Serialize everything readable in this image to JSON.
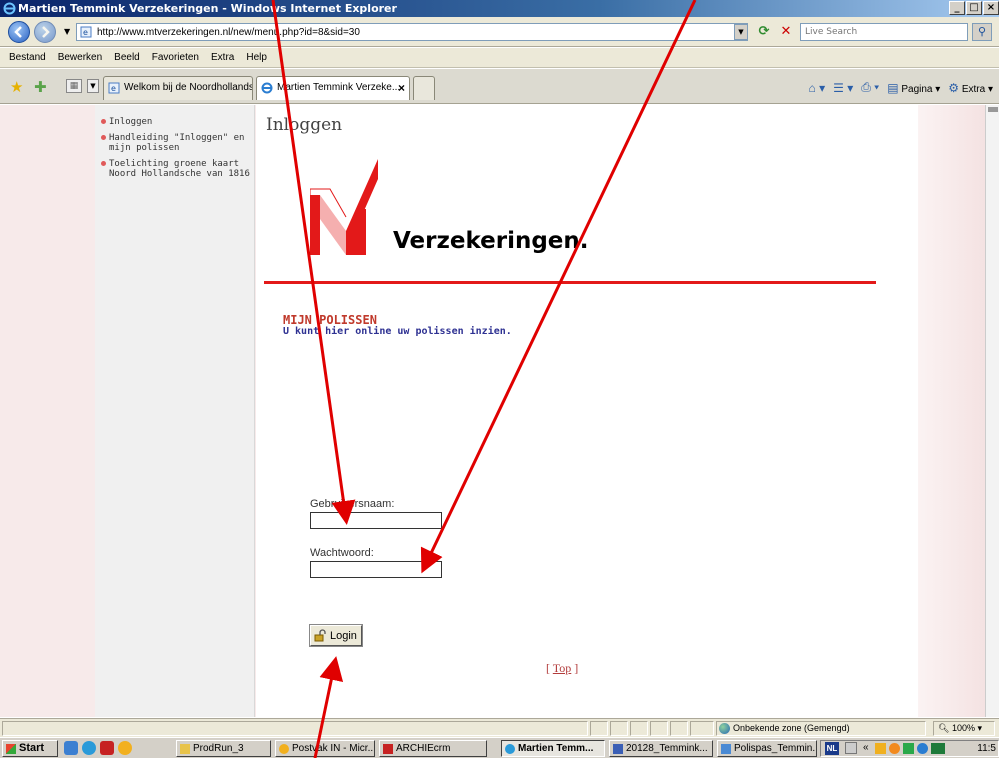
{
  "window": {
    "title": "Martien Temmink Verzekeringen - Windows Internet Explorer",
    "controls": [
      "_",
      "□",
      "×"
    ]
  },
  "addressbar": {
    "url": "http://www.mtverzekeringen.nl/new/menu.php?id=8&sid=30",
    "search_placeholder": "Live Search"
  },
  "menubar": {
    "items": [
      "Bestand",
      "Bewerken",
      "Beeld",
      "Favorieten",
      "Extra",
      "Help"
    ]
  },
  "tabs": [
    {
      "label": "Welkom bij de Noordhollands..."
    },
    {
      "label": "Martien Temmink Verzeke...",
      "close": "×"
    }
  ],
  "commandbar": {
    "page_label": "Pagina",
    "extra_label": "Extra"
  },
  "sidebar": {
    "items": [
      {
        "label": "Inloggen"
      },
      {
        "label": "Handleiding \"Inloggen\" en mijn polissen"
      },
      {
        "label": "Toelichting groene kaart Noord Hollandsche van 1816"
      }
    ]
  },
  "main": {
    "page_title": "Inloggen",
    "brand_text": "Verzekeringen.",
    "heading": "MIJN POLISSEN",
    "subheading": "U kunt hier online uw polissen inzien.",
    "username_label": "Gebruikersnaam:",
    "username_value": "",
    "password_label": "Wachtwoord:",
    "password_value": "",
    "login_label": "Login",
    "top_link_open": "[",
    "top_link": "Top",
    "top_link_close": "]"
  },
  "statusbar": {
    "zone": "Onbekende zone (Gemengd)",
    "zoom": "100%"
  },
  "taskbar": {
    "start": "Start",
    "tasks": [
      {
        "label": "ProdRun_3"
      },
      {
        "label": "Postvak IN - Micr..."
      },
      {
        "label": "ARCHIEcrm"
      },
      {
        "label": "Martien Temm..."
      },
      {
        "label": "20128_Temmink..."
      },
      {
        "label": "Polispas_Temmin..."
      }
    ],
    "language": "NL",
    "clock": "11:5"
  },
  "colors": {
    "accent_red": "#e31919",
    "heading_red": "#c0392b",
    "subheading_blue": "#2e3192",
    "arrow_red": "#e00000"
  }
}
